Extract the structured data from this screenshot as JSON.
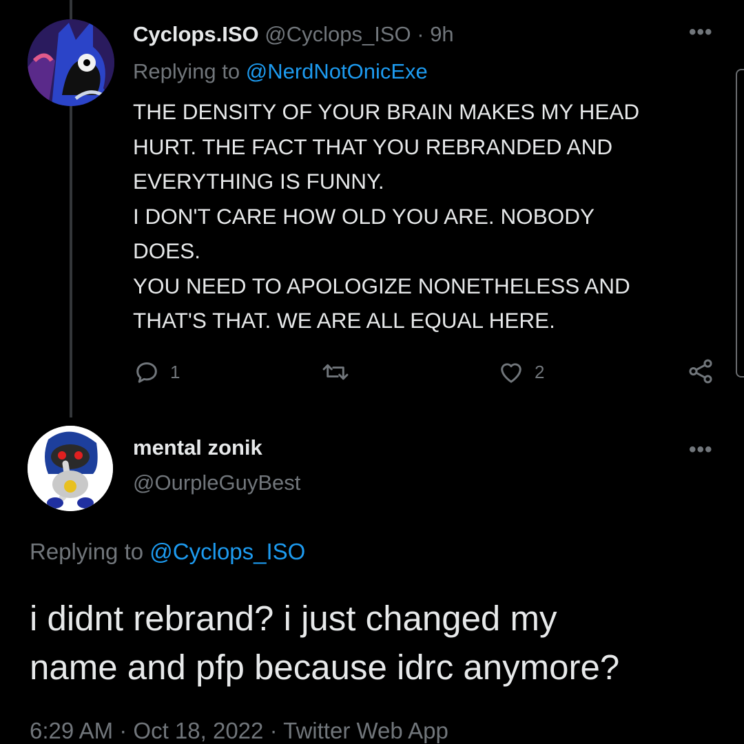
{
  "tweet1": {
    "display_name": "Cyclops.ISO",
    "handle": "@Cyclops_ISO",
    "separator": "·",
    "time": "9h",
    "replying_prefix": "Replying to",
    "replying_handle": "@NerdNotOnicExe",
    "body_lines": [
      "THE DENSITY OF YOUR BRAIN MAKES MY HEAD",
      "HURT. THE FACT THAT YOU REBRANDED AND",
      "EVERYTHING IS FUNNY.",
      "I DON'T CARE HOW OLD YOU ARE. NOBODY",
      "DOES.",
      "YOU NEED TO APOLOGIZE NONETHELESS AND",
      "THAT'S THAT. WE ARE ALL EQUAL HERE."
    ],
    "reply_count": "1",
    "like_count": "2",
    "more_icon": "more-horizontal-icon"
  },
  "tweet2": {
    "display_name": "mental zonik",
    "handle": "@OurpleGuyBest",
    "replying_prefix": "Replying to",
    "replying_handle": "@Cyclops_ISO",
    "body_lines": [
      "i didnt rebrand? i just changed my",
      "name and pfp because idrc anymore?"
    ],
    "time": "6:29 AM",
    "separator": "·",
    "date": "Oct 18, 2022",
    "source": "Twitter Web App",
    "more_icon": "more-horizontal-icon"
  },
  "colors": {
    "background": "#000000",
    "text": "#e7e9ea",
    "muted": "#71767b",
    "link": "#1d9bf0",
    "thread_line": "#333639"
  }
}
